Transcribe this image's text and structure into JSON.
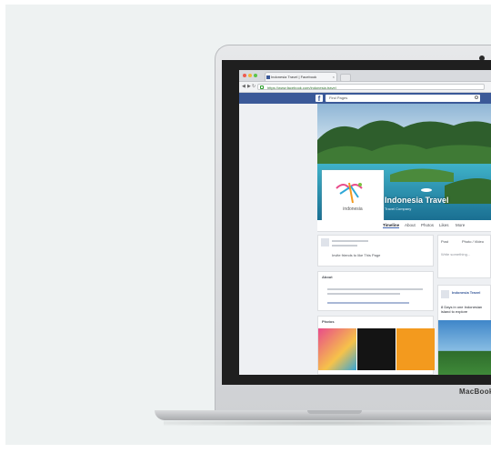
{
  "browser": {
    "tab_title": "Indonesia Travel | Facebook",
    "url": "https://www.facebook.com/indonesia.travel",
    "search_placeholder": "Find Pages"
  },
  "page": {
    "name": "Indonesia Travel",
    "category": "Travel Company",
    "profile_logo_text": "indonesia",
    "tabs": [
      "Timeline",
      "About",
      "Photos",
      "Likes",
      "More"
    ]
  },
  "cards": {
    "invite_label": "Invite friends to like This Page",
    "about_title": "About",
    "photos_title": "Photos",
    "status_label": "Post",
    "photo_label": "Photo / Video",
    "write_placeholder": "Write something...",
    "post_author": "Indonesia Travel",
    "post_text": "8 Days in one Indonesian island to explore"
  },
  "device": {
    "brand": "MacBook"
  },
  "colors": {
    "facebook_blue": "#3b5998",
    "background": "#eef2f2",
    "photo_orange": "#f39a1e"
  }
}
